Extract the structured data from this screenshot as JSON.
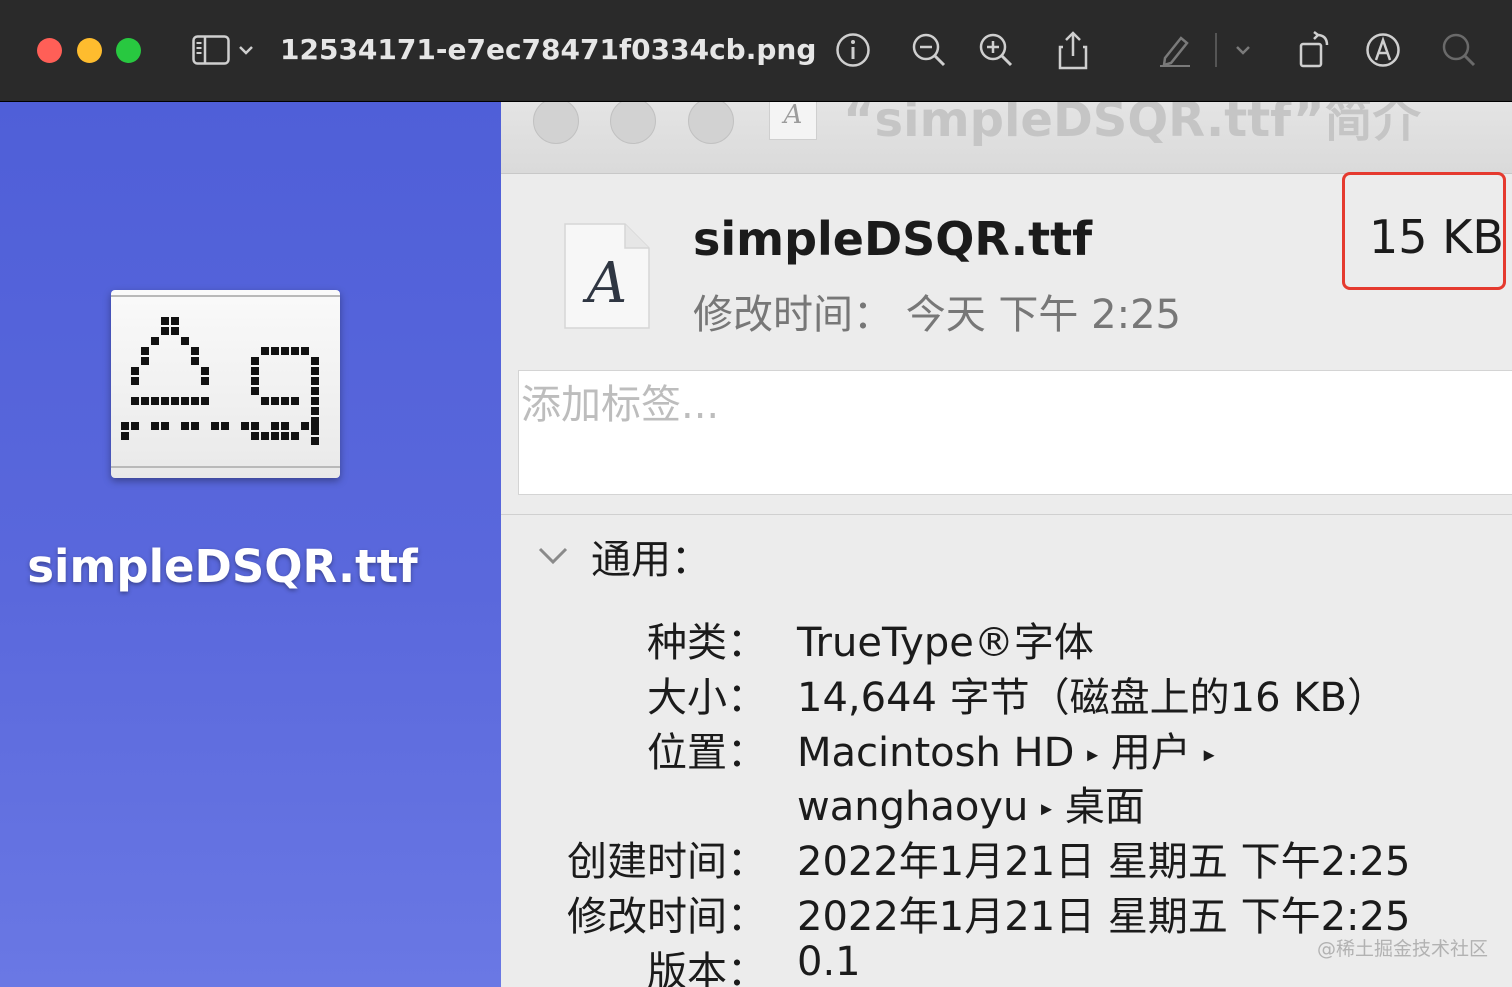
{
  "titlebar": {
    "document_title": "12534171-e7ec78471f0334cb.png",
    "icons": [
      "sidebar-toggle-icon",
      "chevron-down-icon",
      "info-icon",
      "zoom-out-icon",
      "zoom-in-icon",
      "share-icon",
      "markup-pen-icon",
      "rotate-icon",
      "annotate-icon",
      "search-icon"
    ]
  },
  "canvas": {
    "preview_filename": "simpleDSQR.ttf"
  },
  "info_window": {
    "ghost_title": "“simpleDSQR.ttf”简介",
    "file_name": "simpleDSQR.ttf",
    "modified_summary": "修改时间：  今天 下午 2:25",
    "size_summary": "15 KB",
    "icon_letter": "A",
    "ghost_icon_letter": "A",
    "tags_placeholder": "添加标签...",
    "general_section": {
      "title": "通用：",
      "rows": [
        {
          "label": "种类：",
          "value": "TrueType®字体"
        },
        {
          "label": "大小：",
          "value": "14,644 字节（磁盘上的16 KB）"
        },
        {
          "label": "位置：",
          "value_parts": [
            "Macintosh HD",
            "用户",
            "wanghaoyu",
            "桌面"
          ]
        },
        {
          "label": "创建时间：",
          "value": "2022年1月21日 星期五 下午2:25"
        },
        {
          "label": "修改时间：",
          "value": "2022年1月21日 星期五 下午2:25"
        },
        {
          "label": "版本：",
          "value": "0.1"
        }
      ]
    }
  },
  "watermark": "@稀土掘金技术社区",
  "colors": {
    "canvas_blue": "#5a68dc",
    "highlight_red": "#e53a2f",
    "titlebar": "#2a2a2a"
  }
}
